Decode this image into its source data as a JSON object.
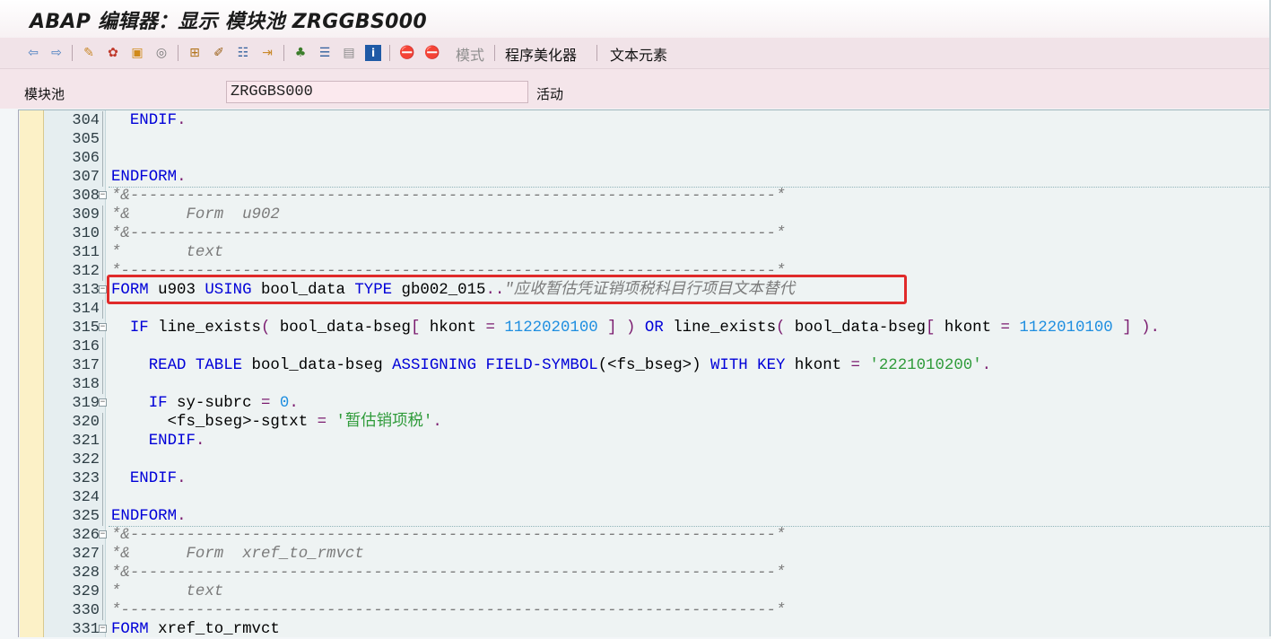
{
  "window": {
    "title": "ABAP 编辑器：显示 模块池 ZRGGBS000"
  },
  "toolbar": {
    "icons": [
      "back-arrow-icon",
      "forward-arrow-icon",
      "other-object-icon",
      "active-inactive-icon",
      "check-icon",
      "activate-icon",
      "where-used-icon",
      "pretty-print-icon",
      "stack-icon",
      "display-object-list-icon",
      "help-on-icon",
      "navigation-icon",
      "create-icon",
      "print-icon",
      "info-icon",
      "breakpoint-icon",
      "session-breakpoint-icon"
    ],
    "pattern_label": "模式",
    "pretty_printer_label": "程序美化器",
    "text_elements_label": "文本元素"
  },
  "header": {
    "program_type_label": "模块池",
    "program_name": "ZRGGBS000",
    "status": "活动"
  },
  "editor": {
    "lines": [
      {
        "no": "304",
        "code": [
          {
            "t": "  "
          },
          {
            "t": "ENDIF",
            "c": "kw"
          },
          {
            "t": ".",
            "c": "pr"
          }
        ]
      },
      {
        "no": "305",
        "code": []
      },
      {
        "no": "306",
        "code": []
      },
      {
        "no": "307",
        "code": [
          {
            "t": "ENDFORM",
            "c": "kw"
          },
          {
            "t": ".",
            "c": "pr"
          }
        ]
      },
      {
        "no": "308",
        "code": [
          {
            "t": "*&---------------------------------------------------------------------*",
            "c": "cm"
          }
        ]
      },
      {
        "no": "309",
        "code": [
          {
            "t": "*&      Form  u902",
            "c": "cm"
          }
        ]
      },
      {
        "no": "310",
        "code": [
          {
            "t": "*&---------------------------------------------------------------------*",
            "c": "cm"
          }
        ]
      },
      {
        "no": "311",
        "code": [
          {
            "t": "*       text",
            "c": "cm"
          }
        ]
      },
      {
        "no": "312",
        "code": [
          {
            "t": "*----------------------------------------------------------------------*",
            "c": "cm"
          }
        ]
      },
      {
        "no": "313",
        "code": [
          {
            "t": "FORM",
            "c": "kw"
          },
          {
            "t": " u903 "
          },
          {
            "t": "USING",
            "c": "kw"
          },
          {
            "t": " bool_data "
          },
          {
            "t": "TYPE",
            "c": "kw"
          },
          {
            "t": " gb002_015"
          },
          {
            "t": "..",
            "c": "pr"
          },
          {
            "t": "\"应收暂估凭证销项税科目行项目文本替代",
            "c": "cm"
          }
        ]
      },
      {
        "no": "314",
        "code": []
      },
      {
        "no": "315",
        "code": [
          {
            "t": "  "
          },
          {
            "t": "IF",
            "c": "kw"
          },
          {
            "t": " line_exists"
          },
          {
            "t": "(",
            "c": "pr"
          },
          {
            "t": " bool_data-bseg"
          },
          {
            "t": "[",
            "c": "pr"
          },
          {
            "t": " hkont "
          },
          {
            "t": "=",
            "c": "pr"
          },
          {
            "t": " "
          },
          {
            "t": "1122020100",
            "c": "num"
          },
          {
            "t": " "
          },
          {
            "t": "]",
            "c": "pr"
          },
          {
            "t": " "
          },
          {
            "t": ")",
            "c": "pr"
          },
          {
            "t": " "
          },
          {
            "t": "OR",
            "c": "kw"
          },
          {
            "t": " line_exists"
          },
          {
            "t": "(",
            "c": "pr"
          },
          {
            "t": " bool_data-bseg"
          },
          {
            "t": "[",
            "c": "pr"
          },
          {
            "t": " hkont "
          },
          {
            "t": "=",
            "c": "pr"
          },
          {
            "t": " "
          },
          {
            "t": "1122010100",
            "c": "num"
          },
          {
            "t": " "
          },
          {
            "t": "]",
            "c": "pr"
          },
          {
            "t": " "
          },
          {
            "t": ")",
            "c": "pr"
          },
          {
            "t": ".",
            "c": "pr"
          }
        ]
      },
      {
        "no": "316",
        "code": []
      },
      {
        "no": "317",
        "code": [
          {
            "t": "    "
          },
          {
            "t": "READ TABLE",
            "c": "kw"
          },
          {
            "t": " bool_data-bseg "
          },
          {
            "t": "ASSIGNING FIELD-SYMBOL",
            "c": "kw"
          },
          {
            "t": "("
          },
          {
            "t": "<fs_bseg>"
          },
          {
            "t": ")"
          },
          {
            "t": " "
          },
          {
            "t": "WITH KEY",
            "c": "kw"
          },
          {
            "t": " hkont "
          },
          {
            "t": "=",
            "c": "pr"
          },
          {
            "t": " "
          },
          {
            "t": "'2221010200'",
            "c": "str"
          },
          {
            "t": ".",
            "c": "pr"
          }
        ]
      },
      {
        "no": "318",
        "code": []
      },
      {
        "no": "319",
        "code": [
          {
            "t": "    "
          },
          {
            "t": "IF",
            "c": "kw"
          },
          {
            "t": " sy-subrc "
          },
          {
            "t": "=",
            "c": "pr"
          },
          {
            "t": " "
          },
          {
            "t": "0",
            "c": "num"
          },
          {
            "t": ".",
            "c": "pr"
          }
        ]
      },
      {
        "no": "320",
        "code": [
          {
            "t": "      <fs_bseg>-sgtxt "
          },
          {
            "t": "=",
            "c": "pr"
          },
          {
            "t": " "
          },
          {
            "t": "'暂估销项税'",
            "c": "str"
          },
          {
            "t": ".",
            "c": "pr"
          }
        ]
      },
      {
        "no": "321",
        "code": [
          {
            "t": "    "
          },
          {
            "t": "ENDIF",
            "c": "kw"
          },
          {
            "t": ".",
            "c": "pr"
          }
        ]
      },
      {
        "no": "322",
        "code": []
      },
      {
        "no": "323",
        "code": [
          {
            "t": "  "
          },
          {
            "t": "ENDIF",
            "c": "kw"
          },
          {
            "t": ".",
            "c": "pr"
          }
        ]
      },
      {
        "no": "324",
        "code": []
      },
      {
        "no": "325",
        "code": [
          {
            "t": "ENDFORM",
            "c": "kw"
          },
          {
            "t": ".",
            "c": "pr"
          }
        ]
      },
      {
        "no": "326",
        "code": [
          {
            "t": "*&---------------------------------------------------------------------*",
            "c": "cm"
          }
        ]
      },
      {
        "no": "327",
        "code": [
          {
            "t": "*&      Form  xref_to_rmvct",
            "c": "cm"
          }
        ]
      },
      {
        "no": "328",
        "code": [
          {
            "t": "*&---------------------------------------------------------------------*",
            "c": "cm"
          }
        ]
      },
      {
        "no": "329",
        "code": [
          {
            "t": "*       text",
            "c": "cm"
          }
        ]
      },
      {
        "no": "330",
        "code": [
          {
            "t": "*----------------------------------------------------------------------*",
            "c": "cm"
          }
        ]
      },
      {
        "no": "331",
        "code": [
          {
            "t": "FORM",
            "c": "kw"
          },
          {
            "t": " xref_to_rmvct"
          }
        ]
      }
    ]
  }
}
